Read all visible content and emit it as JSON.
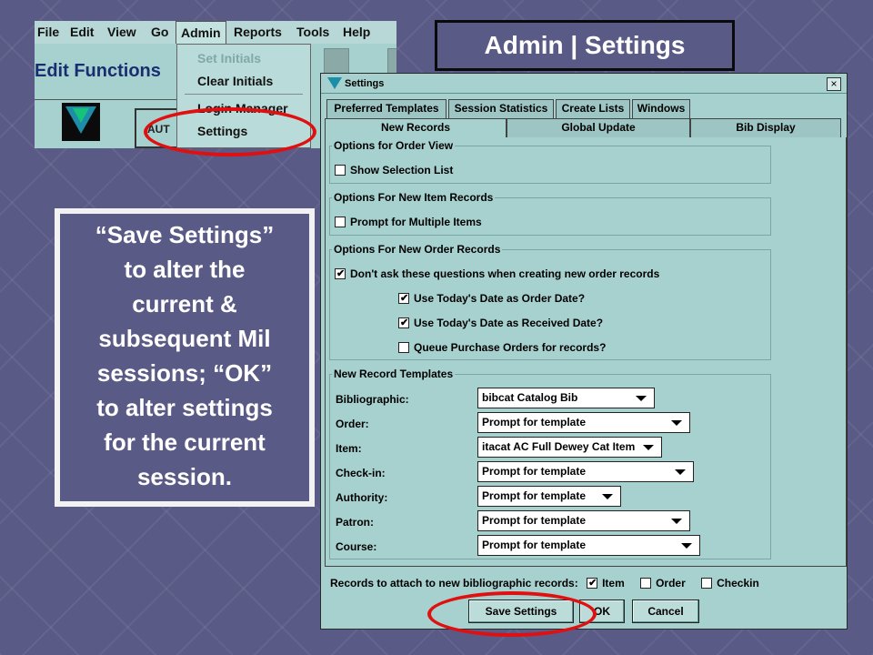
{
  "slide": {
    "title": "Admin | Settings",
    "callout_lines": [
      "“Save Settings”",
      "to alter the",
      "current &",
      "subsequent Mil",
      "sessions; “OK”",
      "to alter settings",
      "for the current",
      "session."
    ],
    "annotation_color": "#e01010"
  },
  "app": {
    "menubar": [
      "File",
      "Edit",
      "View",
      "Go",
      "Admin",
      "Reports",
      "Tools",
      "Help"
    ],
    "panel_title": "Edit Functions",
    "side_stub": "AUT",
    "admin_menu": [
      {
        "label": "Set Initials",
        "enabled": false
      },
      {
        "label": "Clear Initials",
        "enabled": true
      },
      {
        "label": "Login Manager",
        "enabled": true
      },
      {
        "label": "Settings",
        "enabled": true
      }
    ]
  },
  "dialog": {
    "title": "Settings",
    "close_glyph": "×",
    "tabs_row1": [
      "Preferred Templates",
      "Session Statistics",
      "Create Lists",
      "Windows"
    ],
    "tabs_row2": [
      "New Records",
      "Global Update",
      "Bib Display"
    ],
    "active_tab": "New Records",
    "groups": {
      "order_view": {
        "label": "Options for Order View",
        "show_selection_list": {
          "label": "Show Selection List",
          "checked": false
        }
      },
      "new_item": {
        "label": "Options For New Item Records",
        "prompt_multiple": {
          "label": "Prompt for Multiple Items",
          "checked": false
        }
      },
      "new_order": {
        "label": "Options For New Order Records",
        "dont_ask": {
          "label": "Don't ask these questions when creating new order records",
          "checked": true
        },
        "todays_order_date": {
          "label": "Use Today's Date as Order Date?",
          "checked": true
        },
        "todays_received_date": {
          "label": "Use Today's Date as Received Date?",
          "checked": true
        },
        "queue_po": {
          "label": "Queue Purchase Orders for records?",
          "checked": false
        }
      },
      "templates": {
        "label": "New Record Templates",
        "rows": [
          {
            "label": "Bibliographic:",
            "value": "bibcat Catalog Bib"
          },
          {
            "label": "Order:",
            "value": "Prompt for template"
          },
          {
            "label": "Item:",
            "value": "itacat AC Full Dewey Cat Item"
          },
          {
            "label": "Check-in:",
            "value": "Prompt for template"
          },
          {
            "label": "Authority:",
            "value": "Prompt for template"
          },
          {
            "label": "Patron:",
            "value": "Prompt for template"
          },
          {
            "label": "Course:",
            "value": "Prompt for template"
          }
        ]
      }
    },
    "attach": {
      "label": "Records to attach to new bibliographic records:",
      "item": {
        "label": "Item",
        "checked": true
      },
      "order": {
        "label": "Order",
        "checked": false
      },
      "checkin": {
        "label": "Checkin",
        "checked": false
      }
    },
    "buttons": {
      "save": "Save Settings",
      "ok": "OK",
      "cancel": "Cancel"
    }
  }
}
